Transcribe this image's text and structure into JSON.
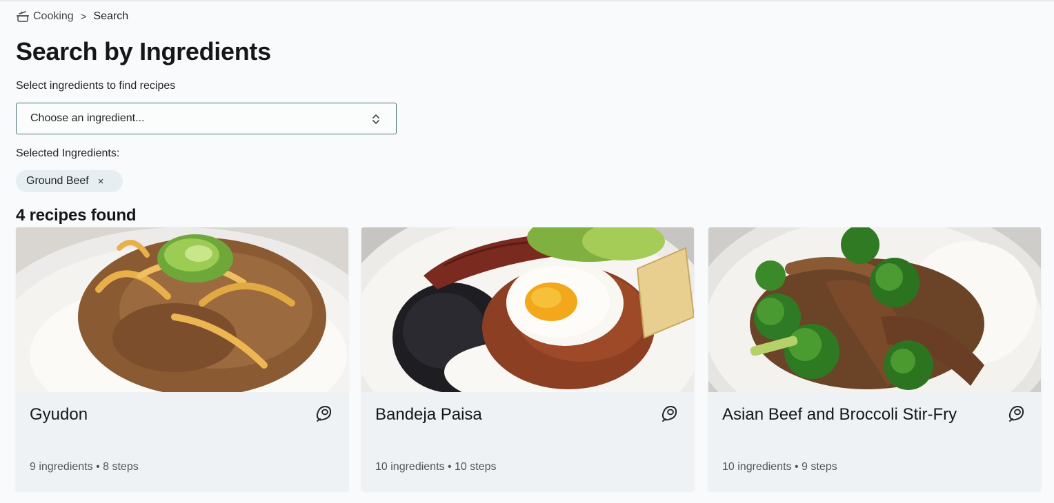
{
  "breadcrumb": {
    "icon": "pot-icon",
    "home": "Cooking",
    "separator": ">",
    "current": "Search"
  },
  "page": {
    "title": "Search by Ingredients",
    "select_label": "Select ingredients to find recipes"
  },
  "ingredient_select": {
    "placeholder": "Choose an ingredient...",
    "icon": "chevron-up-down-icon"
  },
  "selected": {
    "label": "Selected Ingredients:",
    "chips": [
      {
        "label": "Ground Beef",
        "remove": "×"
      }
    ]
  },
  "results": {
    "count_text": "4 recipes found"
  },
  "recipes": [
    {
      "title": "Gyudon",
      "ingredients": "9 ingredients",
      "dot": "•",
      "steps": "8 steps",
      "icon": "meat-icon"
    },
    {
      "title": "Bandeja Paisa",
      "ingredients": "10 ingredients",
      "dot": "•",
      "steps": "10 steps",
      "icon": "meat-icon"
    },
    {
      "title": "Asian Beef and Broccoli Stir-Fry",
      "ingredients": "10 ingredients",
      "dot": "•",
      "steps": "9 steps",
      "icon": "meat-icon"
    }
  ],
  "colors": {
    "background": "#f8fafc",
    "card": "#eef2f5",
    "chip": "#e7eef2",
    "select_border": "#4a6f73"
  }
}
